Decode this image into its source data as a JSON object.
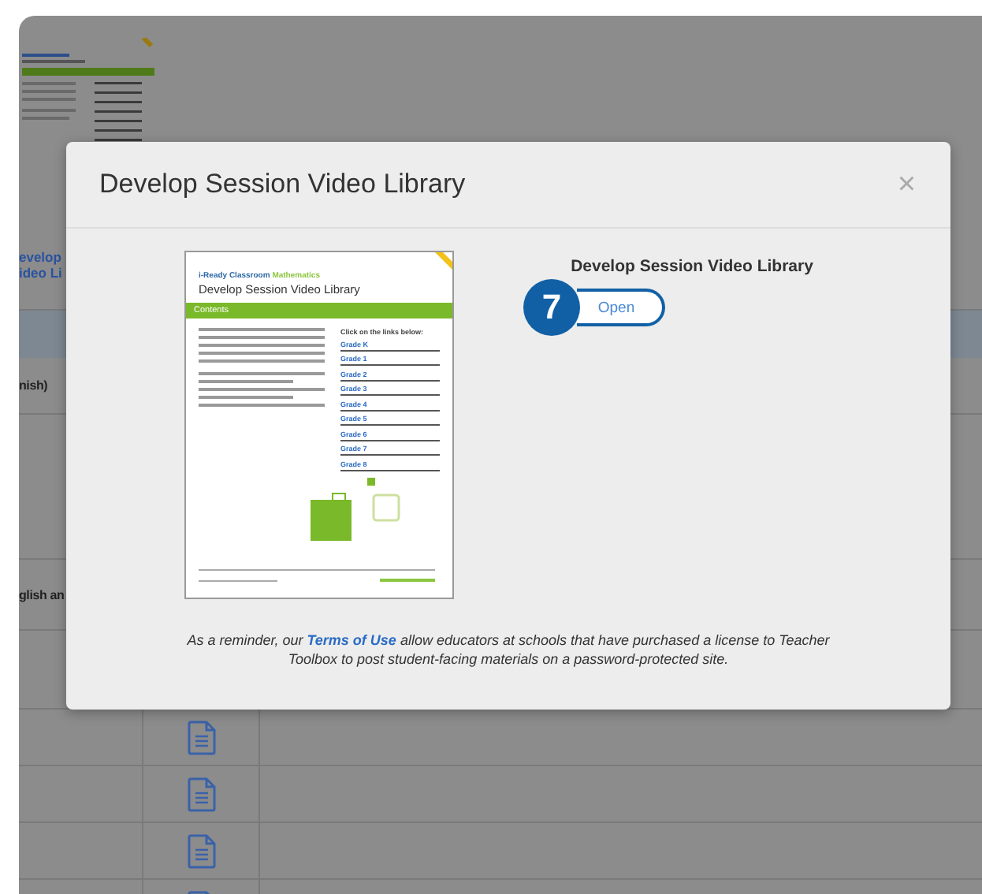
{
  "background_page": {
    "links": [
      "evelop",
      "ideo Li"
    ],
    "rows": [
      {
        "kind": "text",
        "text": "nish)"
      },
      {
        "kind": "blank"
      },
      {
        "kind": "text",
        "text": "glish an"
      },
      {
        "kind": "blank"
      },
      {
        "kind": "file"
      },
      {
        "kind": "file"
      },
      {
        "kind": "file"
      },
      {
        "kind": "file"
      }
    ]
  },
  "modal": {
    "title": "Develop Session Video Library",
    "close": "×",
    "preview": {
      "brand": "i-Ready Classroom",
      "brand_subject": "Mathematics",
      "title": "Develop Session Video Library",
      "band": "Contents",
      "links_heading": "Click on the links below:",
      "links": [
        "Grade K",
        "Grade 1",
        "Grade 2",
        "Grade 3",
        "Grade 4",
        "Grade 5",
        "Grade 6",
        "Grade 7",
        "Grade 8"
      ]
    },
    "resource": {
      "title": "Develop Session Video Library",
      "step": "7",
      "button": "Open"
    },
    "notice": {
      "before": "As a reminder, our",
      "link": "Terms of Use",
      "after": "allow educators at schools that have purchased a license to Teacher Toolbox to post student-facing materials on a password-protected site."
    }
  }
}
